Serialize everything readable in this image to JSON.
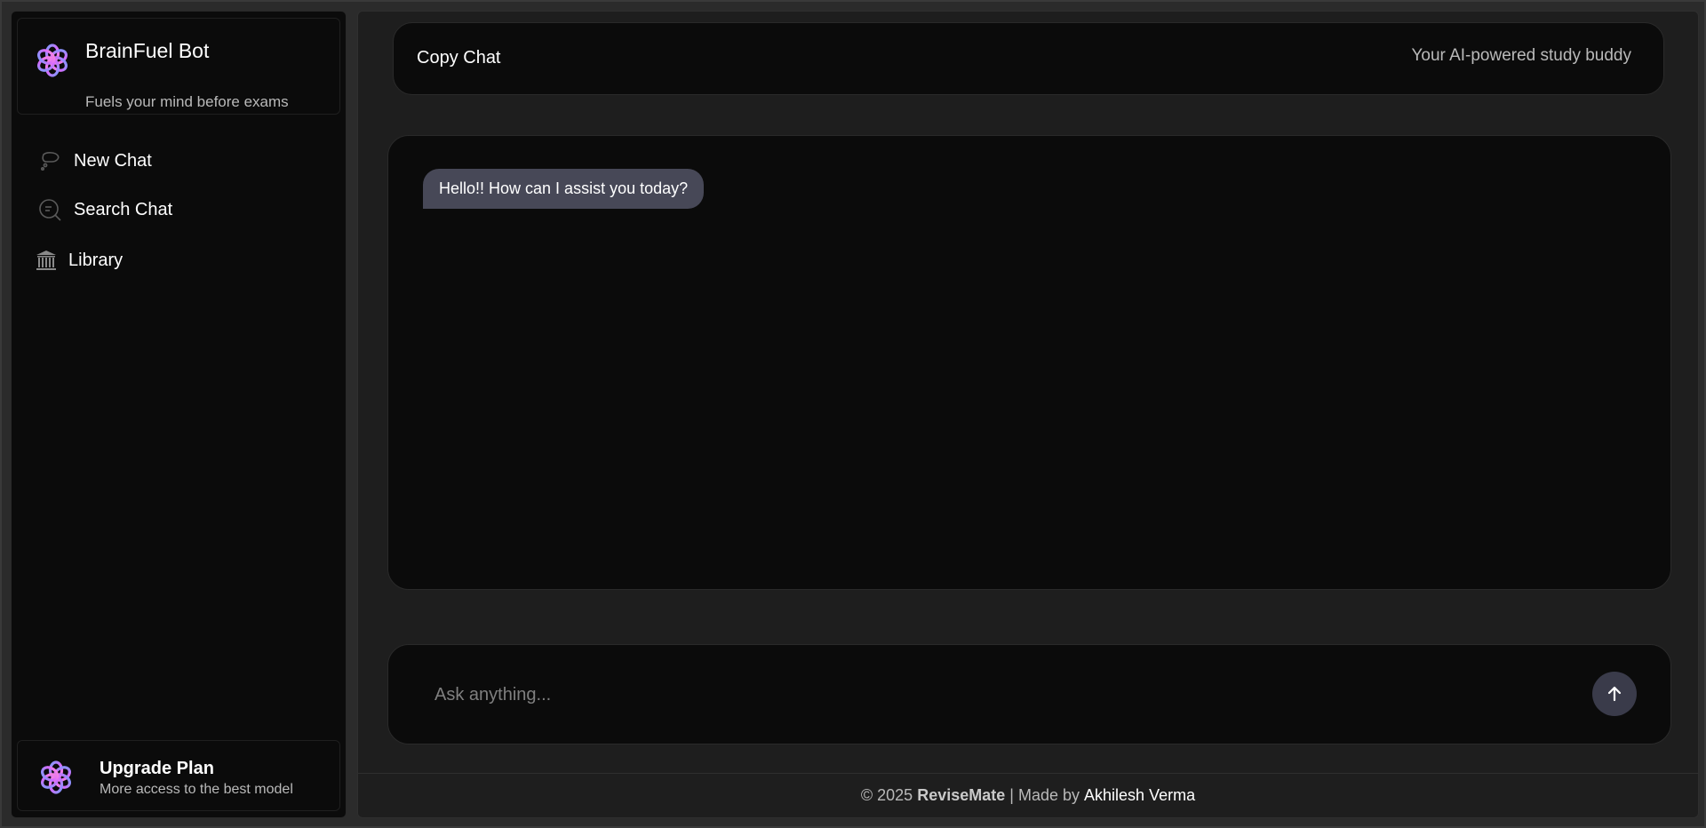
{
  "sidebar": {
    "brand": {
      "name": "BrainFuel Bot",
      "tagline": "Fuels your mind before exams",
      "logo_icon": "openai-flower-icon"
    },
    "nav": [
      {
        "label": "New Chat",
        "icon": "chat-bubble-icon"
      },
      {
        "label": "Search Chat",
        "icon": "search-chat-icon"
      },
      {
        "label": "Library",
        "icon": "library-icon"
      }
    ],
    "upgrade": {
      "title": "Upgrade Plan",
      "subtitle": "More access to the best model",
      "icon": "openai-flower-icon"
    }
  },
  "header": {
    "copy_label": "Copy Chat",
    "tagline": "Your AI-powered study buddy"
  },
  "chat": {
    "messages": [
      {
        "role": "bot",
        "text": "Hello!! How can I assist you today?"
      }
    ]
  },
  "composer": {
    "placeholder": "Ask anything...",
    "send_icon": "arrow-up-icon"
  },
  "footer": {
    "copyright": "© 2025",
    "brand": "ReviseMate",
    "separator": "| Made by",
    "author": "Akhilesh Verma"
  },
  "colors": {
    "background": "#1e1e1e",
    "panel": "#0b0b0b",
    "bubble": "#474857",
    "send_button": "#3a3b4a",
    "logo_gradient": [
      "#7b9cff",
      "#d46bff",
      "#ff8ad8"
    ]
  }
}
